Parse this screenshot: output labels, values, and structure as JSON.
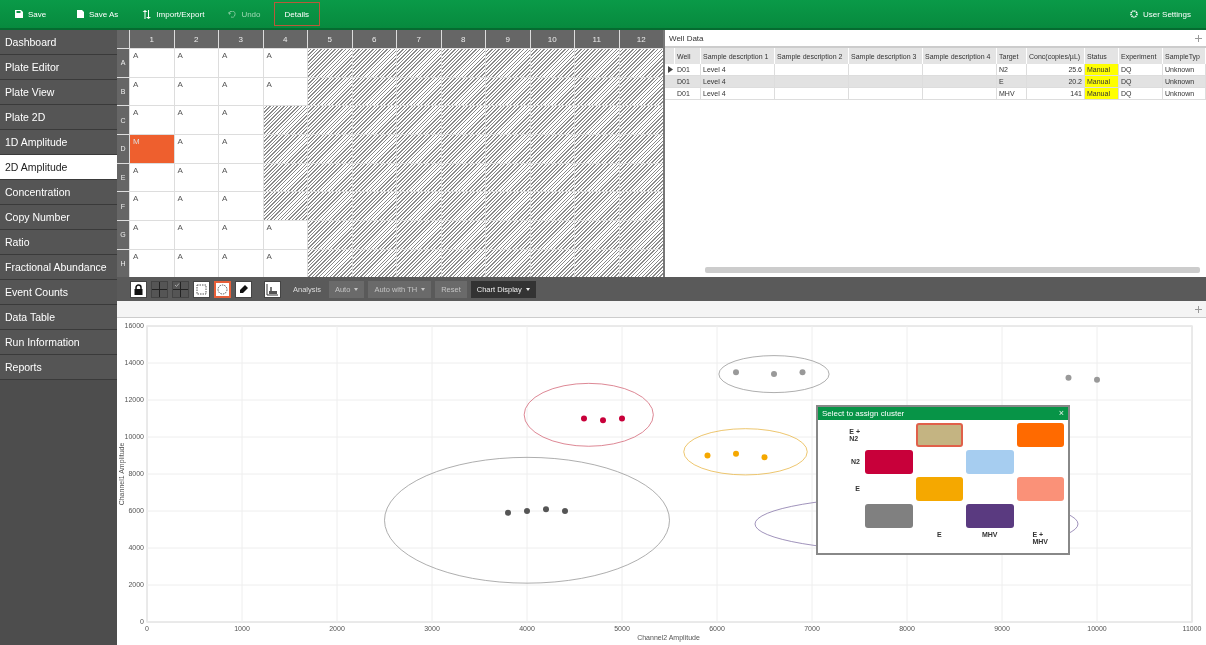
{
  "top_bar": {
    "buttons": [
      {
        "kind": "save",
        "label": "Save",
        "disabled": false,
        "selected": false
      },
      {
        "kind": "save_as",
        "label": "Save As",
        "disabled": false,
        "selected": false
      },
      {
        "kind": "import_export",
        "label": "Import/Export",
        "disabled": false,
        "selected": false
      },
      {
        "kind": "undo",
        "label": "Undo",
        "disabled": true,
        "selected": false
      },
      {
        "kind": "details",
        "label": "Details",
        "disabled": false,
        "selected": true
      }
    ],
    "user_settings": "User Settings"
  },
  "sidebar": {
    "items": [
      {
        "label": "Dashboard",
        "selected": false
      },
      {
        "label": "Plate Editor",
        "selected": false
      },
      {
        "label": "Plate View",
        "selected": false
      },
      {
        "label": "Plate 2D",
        "selected": false
      },
      {
        "label": "1D Amplitude",
        "selected": false
      },
      {
        "label": "2D Amplitude",
        "selected": true
      },
      {
        "label": "Concentration",
        "selected": false
      },
      {
        "label": "Copy Number",
        "selected": false
      },
      {
        "label": "Ratio",
        "selected": false
      },
      {
        "label": "Fractional Abundance",
        "selected": false
      },
      {
        "label": "Event Counts",
        "selected": false
      },
      {
        "label": "Data Table",
        "selected": false
      },
      {
        "label": "Run Information",
        "selected": false
      },
      {
        "label": "Reports",
        "selected": false
      }
    ]
  },
  "plate": {
    "columns": [
      "1",
      "2",
      "3",
      "4",
      "5",
      "6",
      "7",
      "8",
      "9",
      "10",
      "11",
      "12"
    ],
    "rows": [
      {
        "label": "A",
        "wells": [
          {
            "kind": "sample",
            "text": "A",
            "selected": false
          },
          {
            "kind": "sample",
            "text": "A",
            "selected": false
          },
          {
            "kind": "sample",
            "text": "A",
            "selected": false
          },
          {
            "kind": "sample",
            "text": "A",
            "selected": false
          },
          {
            "kind": "empty"
          },
          {
            "kind": "empty"
          },
          {
            "kind": "empty"
          },
          {
            "kind": "empty"
          },
          {
            "kind": "empty"
          },
          {
            "kind": "empty"
          },
          {
            "kind": "empty"
          },
          {
            "kind": "empty"
          }
        ]
      },
      {
        "label": "B",
        "wells": [
          {
            "kind": "sample",
            "text": "A",
            "selected": false
          },
          {
            "kind": "sample",
            "text": "A",
            "selected": false
          },
          {
            "kind": "sample",
            "text": "A",
            "selected": false
          },
          {
            "kind": "sample",
            "text": "A",
            "selected": false
          },
          {
            "kind": "empty"
          },
          {
            "kind": "empty"
          },
          {
            "kind": "empty"
          },
          {
            "kind": "empty"
          },
          {
            "kind": "empty"
          },
          {
            "kind": "empty"
          },
          {
            "kind": "empty"
          },
          {
            "kind": "empty"
          }
        ]
      },
      {
        "label": "C",
        "wells": [
          {
            "kind": "sample",
            "text": "A",
            "selected": false
          },
          {
            "kind": "sample",
            "text": "A",
            "selected": false
          },
          {
            "kind": "sample",
            "text": "A",
            "selected": false
          },
          {
            "kind": "empty"
          },
          {
            "kind": "empty"
          },
          {
            "kind": "empty"
          },
          {
            "kind": "empty"
          },
          {
            "kind": "empty"
          },
          {
            "kind": "empty"
          },
          {
            "kind": "empty"
          },
          {
            "kind": "empty"
          },
          {
            "kind": "empty"
          }
        ]
      },
      {
        "label": "D",
        "wells": [
          {
            "kind": "sample",
            "text": "M",
            "selected": true
          },
          {
            "kind": "sample",
            "text": "A",
            "selected": false
          },
          {
            "kind": "sample",
            "text": "A",
            "selected": false
          },
          {
            "kind": "empty"
          },
          {
            "kind": "empty"
          },
          {
            "kind": "empty"
          },
          {
            "kind": "empty"
          },
          {
            "kind": "empty"
          },
          {
            "kind": "empty"
          },
          {
            "kind": "empty"
          },
          {
            "kind": "empty"
          },
          {
            "kind": "empty"
          }
        ]
      },
      {
        "label": "E",
        "wells": [
          {
            "kind": "sample",
            "text": "A",
            "selected": false
          },
          {
            "kind": "sample",
            "text": "A",
            "selected": false
          },
          {
            "kind": "sample",
            "text": "A",
            "selected": false
          },
          {
            "kind": "empty"
          },
          {
            "kind": "empty"
          },
          {
            "kind": "empty"
          },
          {
            "kind": "empty"
          },
          {
            "kind": "empty"
          },
          {
            "kind": "empty"
          },
          {
            "kind": "empty"
          },
          {
            "kind": "empty"
          },
          {
            "kind": "empty"
          }
        ]
      },
      {
        "label": "F",
        "wells": [
          {
            "kind": "sample",
            "text": "A",
            "selected": false
          },
          {
            "kind": "sample",
            "text": "A",
            "selected": false
          },
          {
            "kind": "sample",
            "text": "A",
            "selected": false
          },
          {
            "kind": "empty"
          },
          {
            "kind": "empty"
          },
          {
            "kind": "empty"
          },
          {
            "kind": "empty"
          },
          {
            "kind": "empty"
          },
          {
            "kind": "empty"
          },
          {
            "kind": "empty"
          },
          {
            "kind": "empty"
          },
          {
            "kind": "empty"
          }
        ]
      },
      {
        "label": "G",
        "wells": [
          {
            "kind": "sample",
            "text": "A",
            "selected": false
          },
          {
            "kind": "sample",
            "text": "A",
            "selected": false
          },
          {
            "kind": "sample",
            "text": "A",
            "selected": false
          },
          {
            "kind": "sample",
            "text": "A",
            "selected": false
          },
          {
            "kind": "empty"
          },
          {
            "kind": "empty"
          },
          {
            "kind": "empty"
          },
          {
            "kind": "empty"
          },
          {
            "kind": "empty"
          },
          {
            "kind": "empty"
          },
          {
            "kind": "empty"
          },
          {
            "kind": "empty"
          }
        ]
      },
      {
        "label": "H",
        "wells": [
          {
            "kind": "sample",
            "text": "A",
            "selected": false
          },
          {
            "kind": "sample",
            "text": "A",
            "selected": false
          },
          {
            "kind": "sample",
            "text": "A",
            "selected": false
          },
          {
            "kind": "sample",
            "text": "A",
            "selected": false
          },
          {
            "kind": "empty"
          },
          {
            "kind": "empty"
          },
          {
            "kind": "empty"
          },
          {
            "kind": "empty"
          },
          {
            "kind": "empty"
          },
          {
            "kind": "empty"
          },
          {
            "kind": "empty"
          },
          {
            "kind": "empty"
          }
        ]
      }
    ]
  },
  "well_data": {
    "title": "Well Data",
    "columns": [
      "Well",
      "Sample description 1",
      "Sample description 2",
      "Sample description 3",
      "Sample description 4",
      "Target",
      "Conc(copies/µL)",
      "Status",
      "Experiment",
      "SampleTyp"
    ],
    "rows": [
      {
        "current": true,
        "selected": false,
        "cells": [
          "D01",
          "Level 4",
          "",
          "",
          "",
          "N2",
          "25.6",
          "Manual",
          "DQ",
          "Unknown"
        ]
      },
      {
        "current": false,
        "selected": true,
        "cells": [
          "D01",
          "Level 4",
          "",
          "",
          "",
          "E",
          "20.2",
          "Manual",
          "DQ",
          "Unknown"
        ]
      },
      {
        "current": false,
        "selected": false,
        "cells": [
          "D01",
          "Level 4",
          "",
          "",
          "",
          "MHV",
          "141",
          "Manual",
          "DQ",
          "Unknown"
        ]
      }
    ]
  },
  "toolbar": {
    "tools": [
      {
        "kind": "lock",
        "selected": false
      },
      {
        "kind": "quad",
        "selected": false
      },
      {
        "kind": "quad_check",
        "selected": false
      },
      {
        "kind": "rect",
        "selected": false
      },
      {
        "kind": "ellipse",
        "selected": true
      },
      {
        "kind": "pen",
        "selected": false
      },
      {
        "kind": "histogram",
        "selected": false
      }
    ],
    "analysis_label": "Analysis",
    "buttons": [
      {
        "label": "Auto",
        "dropdown": true,
        "disabled": true
      },
      {
        "label": "Auto with TH",
        "dropdown": true,
        "disabled": true
      },
      {
        "label": "Reset",
        "dropdown": false,
        "disabled": true
      },
      {
        "label": "Chart Display",
        "dropdown": true,
        "disabled": false
      }
    ]
  },
  "chart": {
    "chart_data": {
      "type": "scatter",
      "xlabel": "Channel2 Amplitude",
      "ylabel": "Channel1 Amplitude",
      "xlim": [
        0,
        11000
      ],
      "ylim": [
        0,
        16000
      ],
      "grid": true,
      "xticks": [
        0,
        1000,
        2000,
        3000,
        4000,
        5000,
        6000,
        7000,
        8000,
        9000,
        10000,
        11000
      ],
      "yticks": [
        0,
        2000,
        4000,
        6000,
        8000,
        10000,
        12000,
        14000,
        16000
      ],
      "x": [
        3800,
        4000,
        4200,
        4400,
        4600,
        4800,
        5000,
        5900,
        6200,
        6500,
        6600,
        6900,
        9700,
        10000
      ],
      "series": [
        {
          "color": "#555555",
          "values": [
            5900,
            6000,
            6100,
            6000,
            null,
            null,
            null,
            null,
            null,
            null,
            null,
            null,
            null,
            null
          ]
        },
        {
          "color": "#c8003a",
          "values": [
            null,
            null,
            null,
            null,
            11000,
            10900,
            11000,
            null,
            null,
            null,
            null,
            null,
            null,
            null
          ]
        },
        {
          "color": "#f5a800",
          "values": [
            null,
            null,
            null,
            null,
            null,
            null,
            null,
            9000,
            9100,
            8900,
            null,
            null,
            null,
            null
          ]
        },
        {
          "color": "#999999",
          "values": [
            null,
            null,
            null,
            null,
            null,
            null,
            null,
            null,
            13500,
            null,
            13400,
            13500,
            13200,
            13100
          ]
        }
      ]
    }
  },
  "cluster_dialog": {
    "title": "Select to assign cluster",
    "close": "×",
    "rows": [
      {
        "label": "E +\nN2",
        "cells": [
          {
            "kind": "blank"
          },
          {
            "kind": "swatch",
            "color": "#c4b482",
            "selected": true
          },
          {
            "kind": "blank"
          },
          {
            "kind": "swatch",
            "color": "#ff6a00",
            "selected": false
          }
        ]
      },
      {
        "label": "N2",
        "cells": [
          {
            "kind": "swatch",
            "color": "#c8003a",
            "selected": false
          },
          {
            "kind": "blank"
          },
          {
            "kind": "swatch",
            "color": "#a6cdf0",
            "selected": false
          },
          {
            "kind": "blank"
          }
        ]
      },
      {
        "label": "E",
        "cells": [
          {
            "kind": "blank"
          },
          {
            "kind": "swatch",
            "color": "#f5a800",
            "selected": false
          },
          {
            "kind": "blank"
          },
          {
            "kind": "swatch",
            "color": "#fa9178",
            "selected": false
          }
        ]
      },
      {
        "cells": [
          {
            "kind": "swatch",
            "color": "#808080",
            "selected": false
          },
          {
            "kind": "blank"
          },
          {
            "kind": "swatch",
            "color": "#5a3a80",
            "selected": false
          },
          {
            "kind": "blank"
          }
        ]
      },
      {
        "cells": [
          {
            "kind": "blank"
          },
          {
            "kind": "label",
            "text": "E"
          },
          {
            "kind": "label",
            "text": "MHV"
          },
          {
            "kind": "label",
            "text": "E +\nMHV"
          }
        ]
      }
    ]
  }
}
